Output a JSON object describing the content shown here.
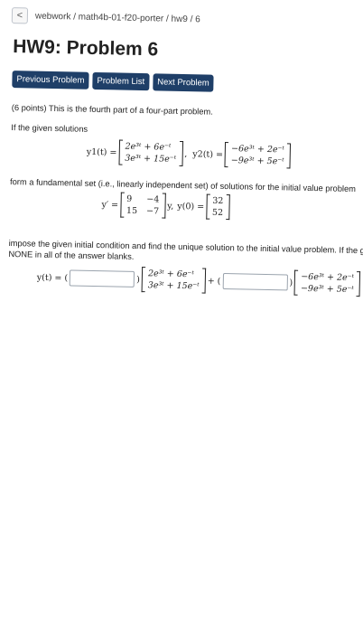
{
  "breadcrumb": {
    "back_glyph": "<",
    "path": "webwork / math4b-01-f20-porter / hw9 / 6"
  },
  "page_title": "HW9: Problem 6",
  "nav": {
    "prev": "Previous Problem",
    "list": "Problem List",
    "next": "Next Problem"
  },
  "problem": {
    "points_text": "(6 points) This is the fourth part of a four-part problem.",
    "intro": "If the given solutions",
    "y1_label": "y1(t) =",
    "y1_top": "2e³ᵗ + 6e⁻ᵗ",
    "y1_bottom": "3e³ᵗ + 15e⁻ᵗ",
    "y2_label": "y2(t) =",
    "y2_top": "−6e³ᵗ + 2e⁻ᵗ",
    "y2_bottom": "−9e³ᵗ + 5e⁻ᵗ",
    "fundamental_text": "form a fundamental set (i.e., linearly independent set) of solutions for the initial value problem",
    "ivp_lhs": "y′ =",
    "matrix": [
      [
        "9",
        "−4"
      ],
      [
        "15",
        "−7"
      ]
    ],
    "ivp_mid": "y,",
    "y0_label": "y(0) =",
    "y0_top": "32",
    "y0_bottom": "52",
    "impose_line1": "impose the given initial condition and find the unique solution to the initial value problem. If the given solutions do not form a fundamental set, enter",
    "impose_line2": "NONE in all of the answer blanks.",
    "answer_label": "y(t) = (",
    "answer_close": ")",
    "plus": "+ (",
    "answer_close2": ")"
  },
  "colors": {
    "nav_button": "#1f3f68"
  }
}
